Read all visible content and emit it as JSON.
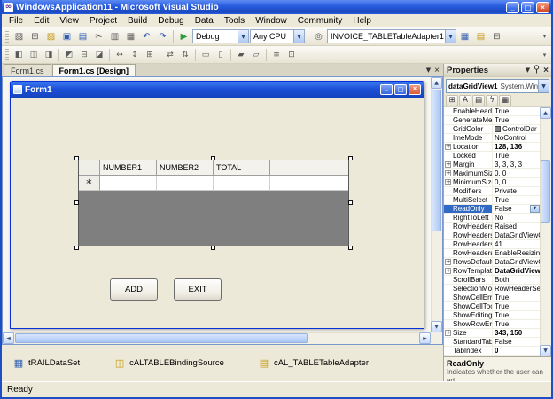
{
  "window": {
    "title": "WindowsApplication11 - Microsoft Visual Studio",
    "logo_glyph": "∞",
    "minimize_glyph": "_",
    "maximize_glyph": "□",
    "close_glyph": "×"
  },
  "glyphs": {
    "combo_arrow": "▼",
    "overflow_chevron": "▾"
  },
  "scrollbar": {
    "up": "▲",
    "down": "▼",
    "left": "◄",
    "right": "►"
  },
  "menu": {
    "items": [
      {
        "label": "File"
      },
      {
        "label": "Edit"
      },
      {
        "label": "View"
      },
      {
        "label": "Project"
      },
      {
        "label": "Build"
      },
      {
        "label": "Debug"
      },
      {
        "label": "Data"
      },
      {
        "label": "Tools"
      },
      {
        "label": "Window"
      },
      {
        "label": "Community"
      },
      {
        "label": "Help"
      }
    ]
  },
  "toolbar_main": {
    "icons_left": [
      {
        "icon": "new-project-icon",
        "glyph": "▧"
      },
      {
        "icon": "add-item-icon",
        "glyph": "⊞"
      },
      {
        "icon": "open-file-icon",
        "glyph": "▨",
        "gold": true
      },
      {
        "icon": "save-icon",
        "glyph": "▣",
        "blue": true
      },
      {
        "icon": "save-all-icon",
        "glyph": "▤",
        "blue": true
      },
      {
        "icon": "cut-icon",
        "glyph": "✂"
      },
      {
        "icon": "copy-icon",
        "glyph": "▥"
      },
      {
        "icon": "paste-icon",
        "glyph": "▦"
      },
      {
        "icon": "undo-icon",
        "glyph": "↶",
        "blue": true
      },
      {
        "icon": "redo-icon",
        "glyph": "↷",
        "blue": true
      }
    ],
    "start_debug_glyph": "▶",
    "debug_combo": "Debug",
    "platform_combo": "Any CPU",
    "find_icon_glyph": "◎",
    "adapter_combo": "INVOICE_TABLETableAdapter1",
    "icons_right": [
      {
        "icon": "preview-data-icon",
        "glyph": "▦",
        "blue": true
      },
      {
        "icon": "database-icon",
        "glyph": "▤",
        "gold": true
      },
      {
        "icon": "solution-explorer-icon",
        "glyph": "⊟"
      }
    ]
  },
  "toolbar_layout": {
    "icons": [
      {
        "icon": "align-lefts-icon",
        "glyph": "◧"
      },
      {
        "icon": "align-centers-icon",
        "glyph": "◫"
      },
      {
        "icon": "align-rights-icon",
        "glyph": "◨"
      },
      {
        "icon": "separator",
        "sep": true
      },
      {
        "icon": "align-tops-icon",
        "glyph": "◩"
      },
      {
        "icon": "align-middles-icon",
        "glyph": "⊟"
      },
      {
        "icon": "align-bottoms-icon",
        "glyph": "◪"
      },
      {
        "icon": "separator",
        "sep": true
      },
      {
        "icon": "same-width-icon",
        "glyph": "↔"
      },
      {
        "icon": "same-height-icon",
        "glyph": "↕"
      },
      {
        "icon": "same-size-icon",
        "glyph": "⊞"
      },
      {
        "icon": "separator",
        "sep": true
      },
      {
        "icon": "horizontal-spacing-icon",
        "glyph": "⇄"
      },
      {
        "icon": "vertical-spacing-icon",
        "glyph": "⇅"
      },
      {
        "icon": "separator",
        "sep": true
      },
      {
        "icon": "center-horizontally-icon",
        "glyph": "▭"
      },
      {
        "icon": "center-vertically-icon",
        "glyph": "▯"
      },
      {
        "icon": "separator",
        "sep": true
      },
      {
        "icon": "bring-to-front-icon",
        "glyph": "▰"
      },
      {
        "icon": "send-to-back-icon",
        "glyph": "▱"
      },
      {
        "icon": "separator",
        "sep": true
      },
      {
        "icon": "tab-order-icon",
        "glyph": "≡"
      },
      {
        "icon": "toolbox-icon",
        "glyph": "⊡"
      }
    ]
  },
  "doc_tabs": {
    "tabs": [
      {
        "label": "Form1.cs",
        "active": false
      },
      {
        "label": "Form1.cs [Design]",
        "active": true
      }
    ],
    "dropdown_glyph": "▼",
    "close_glyph": "×"
  },
  "designer": {
    "form_title": "Form1",
    "form_min_glyph": "_",
    "form_max_glyph": "□",
    "form_close_glyph": "×",
    "grid": {
      "columns": [
        {
          "label": "NUMBER1"
        },
        {
          "label": "NUMBER2"
        },
        {
          "label": "TOTAL"
        }
      ],
      "new_row_glyph": "∗"
    },
    "buttons": [
      {
        "label": "ADD"
      },
      {
        "label": "EXIT"
      }
    ]
  },
  "tray": {
    "items": [
      {
        "icon": "dataset-icon",
        "glyph": "▦",
        "blue": true,
        "label": "tRAILDataSet"
      },
      {
        "icon": "bindingsource-icon",
        "glyph": "◫",
        "gold": true,
        "label": "cALTABLEBindingSource"
      },
      {
        "icon": "tableadapter-icon",
        "glyph": "▤",
        "gold": true,
        "label": "cAL_TABLETableAdapter"
      }
    ]
  },
  "properties": {
    "panel_title": "Properties",
    "object_name": "dataGridView1",
    "object_type": "System.Windows",
    "expand_glyph": "+",
    "value_dropdown_glyph": "▼",
    "toolbar_icons": [
      {
        "icon": "categorized-icon",
        "glyph": "⊞"
      },
      {
        "icon": "alphabetical-icon",
        "glyph": "A"
      },
      {
        "icon": "properties-icon",
        "glyph": "▤"
      },
      {
        "icon": "events-icon",
        "glyph": "ϟ"
      },
      {
        "icon": "property-pages-icon",
        "glyph": "▦"
      }
    ],
    "rows": [
      {
        "name": "EnableHeaders",
        "value": "True"
      },
      {
        "name": "GenerateMemb",
        "value": "True"
      },
      {
        "name": "GridColor",
        "value": "ControlDar",
        "swatch": true
      },
      {
        "name": "ImeMode",
        "value": "NoControl"
      },
      {
        "name": "Location",
        "value": "128, 136",
        "bold": true,
        "expand": true
      },
      {
        "name": "Locked",
        "value": "True"
      },
      {
        "name": "Margin",
        "value": "3, 3, 3, 3",
        "expand": true
      },
      {
        "name": "MaximumSize",
        "value": "0, 0",
        "expand": true
      },
      {
        "name": "MinimumSize",
        "value": "0, 0",
        "expand": true
      },
      {
        "name": "Modifiers",
        "value": "Private"
      },
      {
        "name": "MultiSelect",
        "value": "True"
      },
      {
        "name": "ReadOnly",
        "value": "False",
        "selected": true,
        "dropdown": true
      },
      {
        "name": "RightToLeft",
        "value": "No"
      },
      {
        "name": "RowHeadersBo",
        "value": "Raised"
      },
      {
        "name": "RowHeadersVi",
        "value": "DataGridViewCe"
      },
      {
        "name": "RowHeadersWi",
        "value": "41"
      },
      {
        "name": "RowHeadersWi",
        "value": "EnableResizing"
      },
      {
        "name": "RowsDefaultCe",
        "value": "DataGridViewC",
        "expand": true
      },
      {
        "name": "RowTemplate",
        "value": "DataGridView",
        "bold": true,
        "expand": true
      },
      {
        "name": "ScrollBars",
        "value": "Both"
      },
      {
        "name": "SelectionMode",
        "value": "RowHeaderSele"
      },
      {
        "name": "ShowCellErrors",
        "value": "True"
      },
      {
        "name": "ShowCellToolTi",
        "value": "True"
      },
      {
        "name": "ShowEditingIco",
        "value": "True"
      },
      {
        "name": "ShowRowError",
        "value": "True"
      },
      {
        "name": "Size",
        "value": "343, 150",
        "bold": true,
        "expand": true
      },
      {
        "name": "StandardTab",
        "value": "False"
      },
      {
        "name": "TabIndex",
        "value": "0",
        "bold": true
      }
    ],
    "description": {
      "title": "ReadOnly",
      "text": "Indicates whether the user can ed..."
    }
  },
  "statusbar": {
    "text": "Ready"
  }
}
